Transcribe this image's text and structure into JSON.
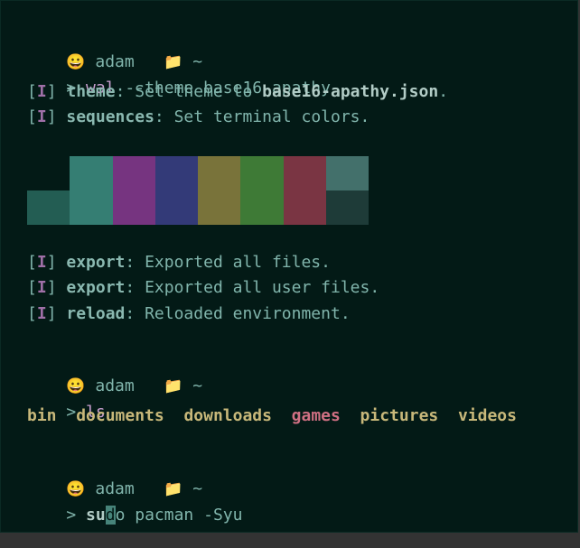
{
  "prompt1": {
    "emoji": "😀",
    "user": "adam",
    "folder_icon": "📁",
    "dir": "~"
  },
  "cmd1": {
    "prompt": ">",
    "command": "wal",
    "args": " --theme base16-apathy"
  },
  "log1": {
    "lb": "[",
    "flag": "I",
    "rb": "]",
    "key": "theme",
    "text": ": Set theme to ",
    "value": "base16-apathy.json",
    "end": "."
  },
  "log2": {
    "lb": "[",
    "flag": "I",
    "rb": "]",
    "key": "sequences",
    "text": ": Set terminal colors."
  },
  "palette": {
    "colors": [
      "#235d53",
      "#357e73",
      "#763480",
      "#333a78",
      "#79733a",
      "#3e7a36",
      "#7a3543",
      "#43706b"
    ],
    "dark_bottom_first": "#235d53",
    "dark_bottom_last": "#1e3b38"
  },
  "log3": {
    "lb": "[",
    "flag": "I",
    "rb": "]",
    "key": "export",
    "text": ": Exported all files."
  },
  "log4": {
    "lb": "[",
    "flag": "I",
    "rb": "]",
    "key": "export",
    "text": ": Exported all user files."
  },
  "log5": {
    "lb": "[",
    "flag": "I",
    "rb": "]",
    "key": "reload",
    "text": ": Reloaded environment."
  },
  "prompt2": {
    "emoji": "😀",
    "user": "adam",
    "folder_icon": "📁",
    "dir": "~"
  },
  "cmd2": {
    "prompt": ">",
    "command": "ls"
  },
  "ls_output": [
    "bin",
    "documents",
    "downloads",
    "games",
    "pictures",
    "videos"
  ],
  "prompt3": {
    "emoji": "😀",
    "user": "adam",
    "folder_icon": "📁",
    "dir": "~"
  },
  "cmd3": {
    "prompt": ">",
    "before_cursor": "su",
    "cursor": "d",
    "after_cursor": "o pacman -Syu"
  }
}
